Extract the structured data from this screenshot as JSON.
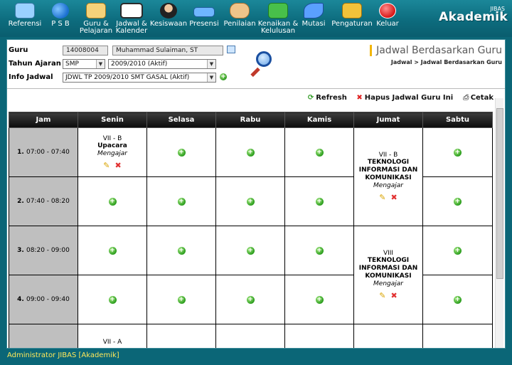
{
  "nav": [
    {
      "name": "referensi",
      "l1": "Referensi",
      "l2": "",
      "icon": "monitor-icon",
      "color": "#9ad1ff"
    },
    {
      "name": "psb",
      "l1": "P S B",
      "l2": "",
      "icon": "users-icon",
      "color": "#4da3ff"
    },
    {
      "name": "guru-pelajaran",
      "l1": "Guru &",
      "l2": "Pelajaran",
      "icon": "teacher-icon",
      "color": "#f4d27a"
    },
    {
      "name": "jadwal-kalender",
      "l1": "Jadwal &",
      "l2": "Kalender",
      "icon": "calendar-icon",
      "color": "#ffffff"
    },
    {
      "name": "kesiswaan",
      "l1": "Kesiswaan",
      "l2": "",
      "icon": "student-icon",
      "color": "#333333"
    },
    {
      "name": "presensi",
      "l1": "Presensi",
      "l2": "",
      "icon": "keyboard-icon",
      "color": "#6fb6ff"
    },
    {
      "name": "penilaian",
      "l1": "Penilaian",
      "l2": "",
      "icon": "handshake-icon",
      "color": "#f0c48a"
    },
    {
      "name": "kenaikan-kelulusan",
      "l1": "Kenaikan &",
      "l2": "Kelulusan",
      "icon": "arrows-icon",
      "color": "#48c04a"
    },
    {
      "name": "mutasi",
      "l1": "Mutasi",
      "l2": "",
      "icon": "runner-icon",
      "color": "#5aa0ff"
    },
    {
      "name": "pengaturan",
      "l1": "Pengaturan",
      "l2": "",
      "icon": "tools-icon",
      "color": "#f2c23a"
    },
    {
      "name": "keluar",
      "l1": "Keluar",
      "l2": "",
      "icon": "power-icon",
      "color": "#e02a2a"
    }
  ],
  "brand": {
    "sup": "JIBAS",
    "name": "Akademik"
  },
  "form": {
    "guru_label": "Guru",
    "guru_nip": "14008004",
    "guru_name": "Muhammad Sulaiman, ST",
    "tahun_label": "Tahun Ajaran",
    "tahun_level": "SMP",
    "tahun_value": "2009/2010 (Aktif)",
    "info_label": "Info Jadwal",
    "info_value": "JDWL TP 2009/2010 SMT GASAL (Aktif)"
  },
  "header": {
    "title": "Jadwal Berdasarkan Guru",
    "breadcrumb": "Jadwal  >  Jadwal Berdasarkan Guru"
  },
  "actions": {
    "refresh": "Refresh",
    "hapus": "Hapus Jadwal Guru Ini",
    "cetak": "Cetak"
  },
  "table": {
    "headers": [
      "Jam",
      "Senin",
      "Selasa",
      "Rabu",
      "Kamis",
      "Jumat",
      "Sabtu"
    ],
    "rows": [
      {
        "no": "1.",
        "time": "07:00 - 07:40"
      },
      {
        "no": "2.",
        "time": "07:40 - 08:20"
      },
      {
        "no": "3.",
        "time": "08:20 - 09:00"
      },
      {
        "no": "4.",
        "time": "09:00 - 09:40"
      }
    ],
    "entries": {
      "senin_1": {
        "kelas": "VII - B",
        "pelajaran": "Upacara",
        "ket": "Mengajar"
      },
      "jumat_12": {
        "kelas": "VII - B",
        "pelajaran": "TEKNOLOGI INFORMASI DAN KOMUNIKASI",
        "ket": "Mengajar"
      },
      "jumat_34": {
        "kelas": "VIII",
        "pelajaran": "TEKNOLOGI INFORMASI DAN KOMUNIKASI",
        "ket": "Mengajar"
      },
      "senin_5": {
        "kelas": "VII - A"
      }
    }
  },
  "status": {
    "text": "Administrator JIBAS [Akademik]"
  }
}
